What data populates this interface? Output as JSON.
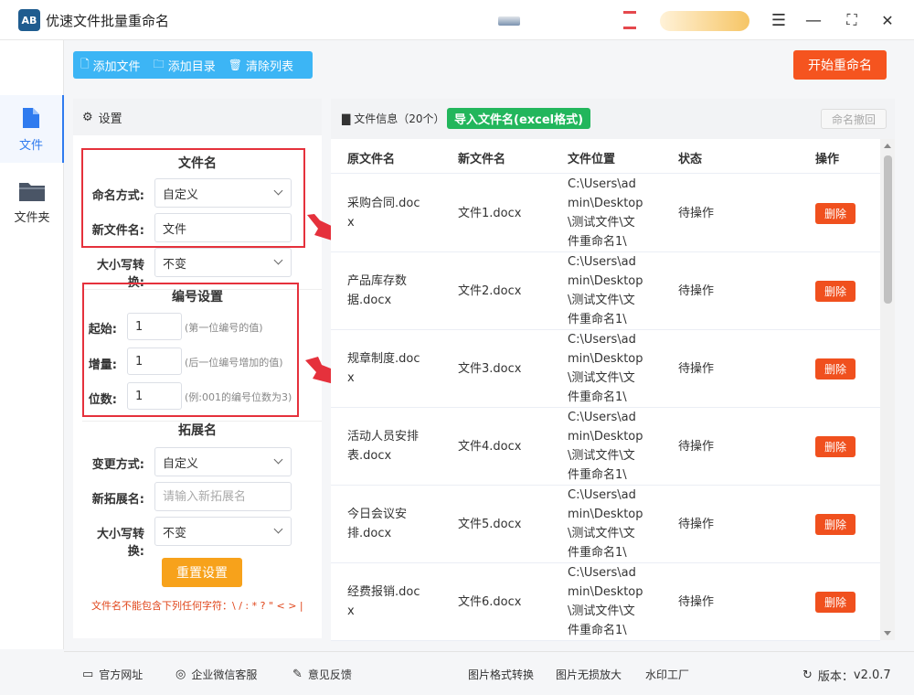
{
  "app": {
    "title": "优速文件批量重命名",
    "logo": "AB"
  },
  "window_controls": {
    "menu": "☰",
    "minimize": "—",
    "maximize": "⛶",
    "close": "✕"
  },
  "nav": {
    "files": "文件",
    "folders": "文件夹"
  },
  "toolbar": {
    "add_file": "添加文件",
    "add_dir": "添加目录",
    "clear_list": "清除列表",
    "start": "开始重命名"
  },
  "settings": {
    "title": "设置",
    "filename": {
      "section": "文件名",
      "method_label": "命名方式:",
      "method_value": "自定义",
      "newname_label": "新文件名:",
      "newname_value": "文件",
      "case_label": "大小写转换:",
      "case_value": "不变"
    },
    "numbering": {
      "section": "编号设置",
      "start_label": "起始:",
      "start_value": "1",
      "start_hint": "(第一位编号的值)",
      "step_label": "增量:",
      "step_value": "1",
      "step_hint": "(后一位编号增加的值)",
      "digits_label": "位数:",
      "digits_value": "1",
      "digits_hint": "(例:001的编号位数为3)"
    },
    "extension": {
      "section": "拓展名",
      "method_label": "变更方式:",
      "method_value": "自定义",
      "newext_label": "新拓展名:",
      "newext_placeholder": "请输入新拓展名",
      "case_label": "大小写转换:",
      "case_value": "不变"
    },
    "reset": "重置设置",
    "warning": "文件名不能包含下列任何字符：\\ / : * ? \" < > |"
  },
  "files": {
    "title": "文件信息",
    "count": "（20个）",
    "import": "导入文件名(excel格式)",
    "undo": "命名撤回",
    "columns": {
      "original": "原文件名",
      "new": "新文件名",
      "location": "文件位置",
      "status": "状态",
      "action": "操作"
    },
    "rows": [
      {
        "original": [
          "采购合同.doc",
          "x"
        ],
        "new": "文件1.docx",
        "location": [
          "C:\\Users\\ad",
          "min\\Desktop",
          "\\测试文件\\文",
          "件重命名1\\"
        ],
        "status": "待操作",
        "action": "删除"
      },
      {
        "original": [
          "产品库存数",
          "据.docx"
        ],
        "new": "文件2.docx",
        "location": [
          "C:\\Users\\ad",
          "min\\Desktop",
          "\\测试文件\\文",
          "件重命名1\\"
        ],
        "status": "待操作",
        "action": "删除"
      },
      {
        "original": [
          "规章制度.doc",
          "x"
        ],
        "new": "文件3.docx",
        "location": [
          "C:\\Users\\ad",
          "min\\Desktop",
          "\\测试文件\\文",
          "件重命名1\\"
        ],
        "status": "待操作",
        "action": "删除"
      },
      {
        "original": [
          "活动人员安排",
          "表.docx"
        ],
        "new": "文件4.docx",
        "location": [
          "C:\\Users\\ad",
          "min\\Desktop",
          "\\测试文件\\文",
          "件重命名1\\"
        ],
        "status": "待操作",
        "action": "删除"
      },
      {
        "original": [
          "今日会议安",
          "排.docx"
        ],
        "new": "文件5.docx",
        "location": [
          "C:\\Users\\ad",
          "min\\Desktop",
          "\\测试文件\\文",
          "件重命名1\\"
        ],
        "status": "待操作",
        "action": "删除"
      },
      {
        "original": [
          "经费报销.doc",
          "x"
        ],
        "new": "文件6.docx",
        "location": [
          "C:\\Users\\ad",
          "min\\Desktop",
          "\\测试文件\\文",
          "件重命名1\\"
        ],
        "status": "待操作",
        "action": "删除"
      }
    ]
  },
  "footer": {
    "website": "官方网址",
    "wechat": "企业微信客服",
    "feedback": "意见反馈",
    "img_convert": "图片格式转换",
    "img_enlarge": "图片无损放大",
    "watermark": "水印工厂",
    "version_label": "版本：",
    "version": "v2.0.7"
  }
}
